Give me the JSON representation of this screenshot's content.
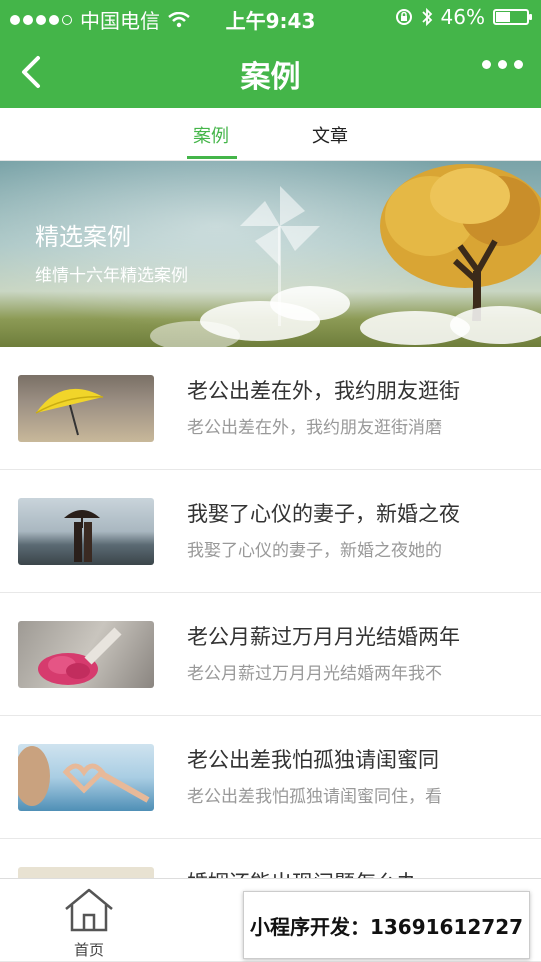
{
  "status": {
    "carrier": "中国电信",
    "time": "上午9:43",
    "battery": "46%",
    "battery_level": 0.46
  },
  "nav": {
    "title": "案例"
  },
  "tabs": [
    {
      "label": "案例"
    },
    {
      "label": "文章"
    }
  ],
  "banner": {
    "heading": "精选案例",
    "subtitle": "维情十六年精选案例"
  },
  "items": [
    {
      "title": "老公出差在外，我约朋友逛街",
      "desc": "老公出差在外，我约朋友逛街消磨"
    },
    {
      "title": "我娶了心仪的妻子，新婚之夜",
      "desc": "我娶了心仪的妻子，新婚之夜她的"
    },
    {
      "title": "老公月薪过万月月光结婚两年",
      "desc": "老公月薪过万月月光结婚两年我不"
    },
    {
      "title": "老公出差我怕孤独请闺蜜同",
      "desc": "老公出差我怕孤独请闺蜜同住，看"
    },
    {
      "title": "婚姻还能出现问题怎么办",
      "desc": ""
    }
  ],
  "tabbar": {
    "home_label": "首页"
  },
  "ad": {
    "text": "小程序开发：13691612727"
  },
  "colors": {
    "primary": "#44b549"
  }
}
